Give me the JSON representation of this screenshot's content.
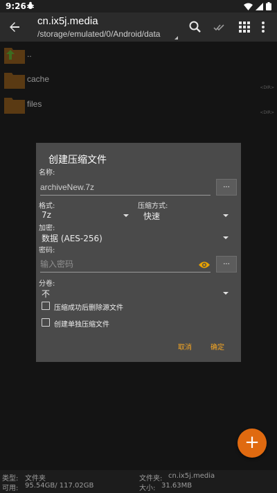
{
  "status": {
    "time": "9:26",
    "notification_icon": "bug-icon"
  },
  "toolbar": {
    "title": "cn.ix5j.media",
    "path": "/storage/emulated/0/Android/data"
  },
  "files": [
    {
      "name": "..",
      "tag": "",
      "icon": "folder-up-icon"
    },
    {
      "name": "cache",
      "tag": "<DIR>",
      "icon": "folder-icon"
    },
    {
      "name": "files",
      "tag": "<DIR>",
      "icon": "folder-icon"
    }
  ],
  "dialog": {
    "title": "创建压缩文件",
    "name_label": "名称:",
    "name_value": "archiveNew.7z",
    "browse_label": "...",
    "format_label": "格式:",
    "format_value": "7z",
    "method_label": "压缩方式:",
    "method_value": "快速",
    "encrypt_label": "加密:",
    "encrypt_value": "数据 (AES-256)",
    "password_label": "密码:",
    "password_placeholder": "输入密码",
    "split_label": "分卷:",
    "split_value": "不",
    "option_delete": "压缩成功后删除源文件",
    "option_separate": "创建单独压缩文件",
    "cancel_label": "取消",
    "ok_label": "确定"
  },
  "fab": {
    "label": "+"
  },
  "info": {
    "type_label": "类型:",
    "type_value": "文件夹",
    "available_label": "可用:",
    "available_value": "95.54GB/ 117.02GB",
    "folder_label": "文件夹:",
    "folder_value": "cn.ix5j.media",
    "size_label": "大小:",
    "size_value": "31.63MB"
  },
  "colors": {
    "accent": "#f5a623",
    "fab": "#e06a10",
    "folder": "#8a5a1e",
    "eye": "#e8a200"
  }
}
